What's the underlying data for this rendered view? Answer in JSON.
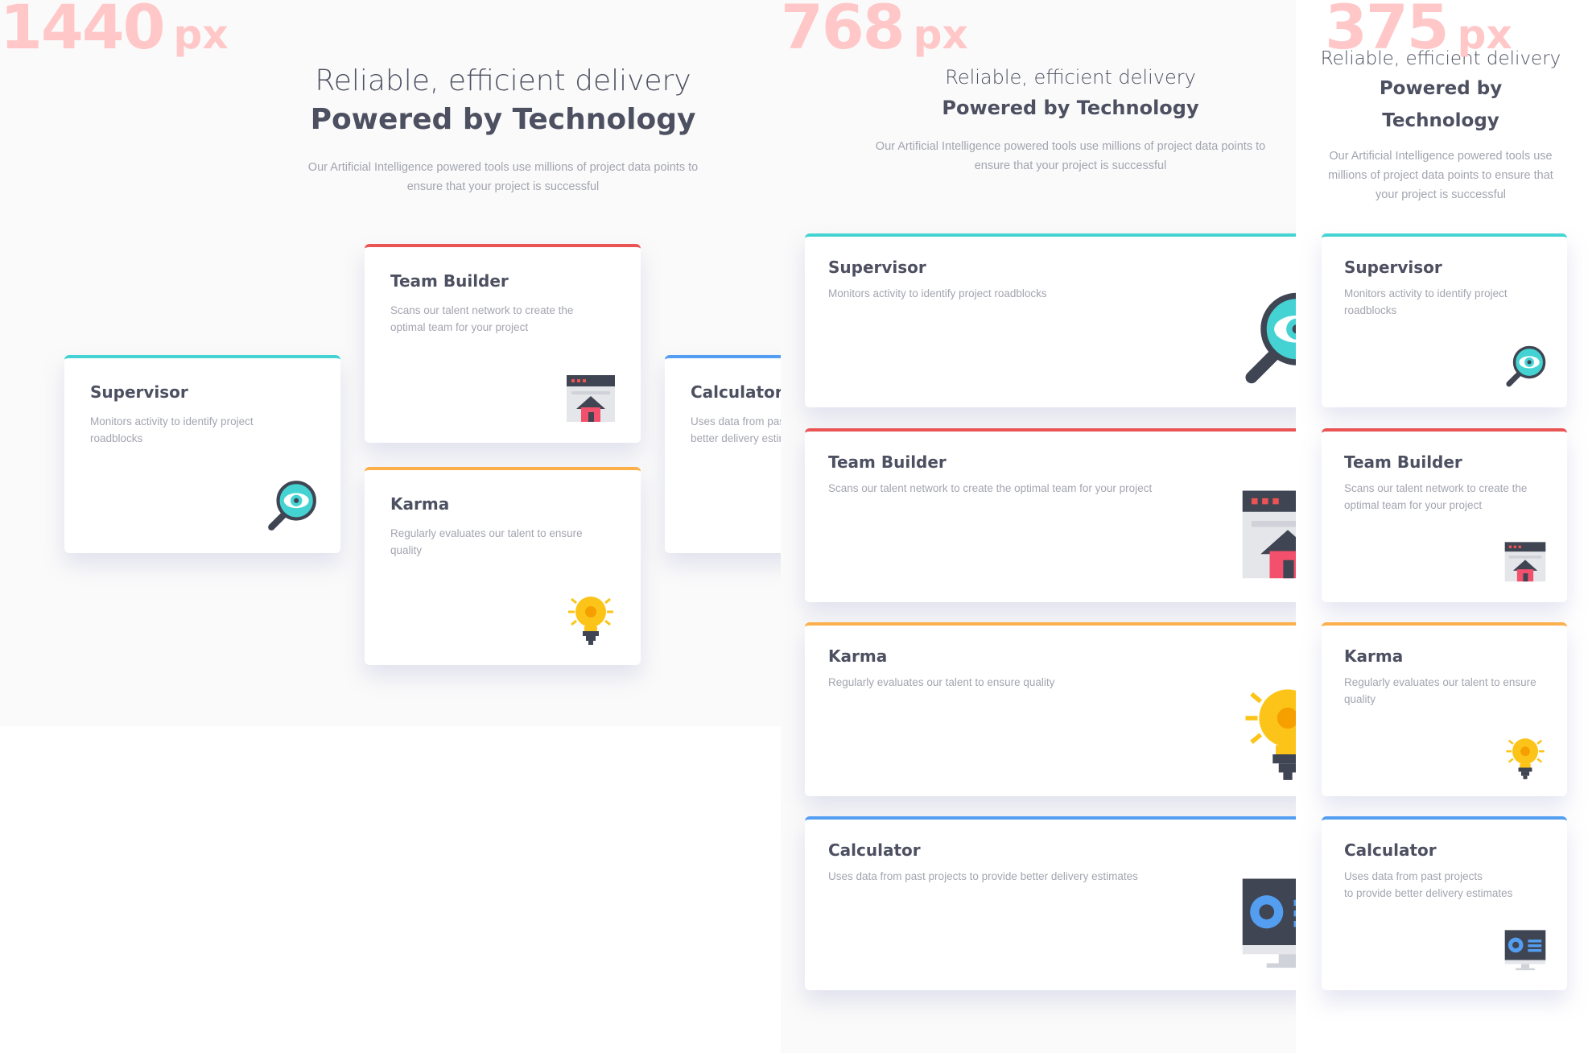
{
  "labels": {
    "desktop": {
      "value": "1440",
      "unit": "px"
    },
    "tablet": {
      "value": "768",
      "unit": "px"
    },
    "mobile": {
      "value": "375",
      "unit": "px"
    }
  },
  "header": {
    "subtitle": "Reliable, efficient delivery",
    "title": "Powered by Technology",
    "intro": "Our Artificial Intelligence powered tools use millions of project data points to ensure that your project is successful"
  },
  "cards": {
    "supervisor": {
      "title": "Supervisor",
      "desc": "Monitors activity to identify project roadblocks",
      "icon": "supervisor-magnifier-icon"
    },
    "team_builder": {
      "title": "Team Builder",
      "desc": "Scans our talent network to create the optimal team for your project",
      "icon": "team-builder-browser-icon"
    },
    "karma": {
      "title": "Karma",
      "desc": "Regularly evaluates our talent to ensure quality",
      "icon": "karma-lightbulb-icon"
    },
    "calculator": {
      "title": "Calculator",
      "desc": "Uses data from past projects to provide better delivery estimates",
      "desc_mobile_line1": "Uses data from past projects",
      "desc_mobile_line2": "to provide better delivery estimates",
      "icon": "calculator-monitor-icon"
    }
  },
  "colors": {
    "cyan": "#44d3d2",
    "red": "#ea5454",
    "orange": "#fcaf4a",
    "blue": "#549ef2",
    "text": "#4d5061",
    "muted": "#a3a5b0"
  }
}
